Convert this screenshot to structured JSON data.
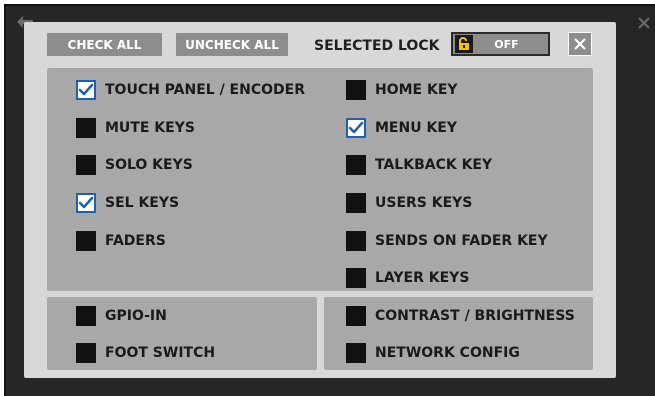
{
  "dialog": {
    "check_all_label": "CHECK ALL",
    "uncheck_all_label": "UNCHECK ALL",
    "selected_lock_label": "SELECTED LOCK",
    "lock_state": "OFF"
  },
  "items": [
    {
      "label": "TOUCH PANEL / ENCODER",
      "checked": true
    },
    {
      "label": "MUTE KEYS",
      "checked": false
    },
    {
      "label": "SOLO KEYS",
      "checked": false
    },
    {
      "label": "SEL KEYS",
      "checked": true
    },
    {
      "label": "FADERS",
      "checked": false
    },
    {
      "label": "HOME KEY",
      "checked": false
    },
    {
      "label": "MENU KEY",
      "checked": true
    },
    {
      "label": "TALKBACK KEY",
      "checked": false
    },
    {
      "label": "USERS KEYS",
      "checked": false
    },
    {
      "label": "SENDS ON FADER KEY",
      "checked": false
    },
    {
      "label": "LAYER KEYS",
      "checked": false
    },
    {
      "label": "GPIO-IN",
      "checked": false
    },
    {
      "label": "FOOT SWITCH",
      "checked": false
    },
    {
      "label": "CONTRAST / BRIGHTNESS",
      "checked": false
    },
    {
      "label": "NETWORK CONFIG",
      "checked": false
    }
  ],
  "colors": {
    "checkbox_accent": "#1d5fb0",
    "lock_icon": "#f2c200",
    "button_gray": "#8d8d8d"
  }
}
